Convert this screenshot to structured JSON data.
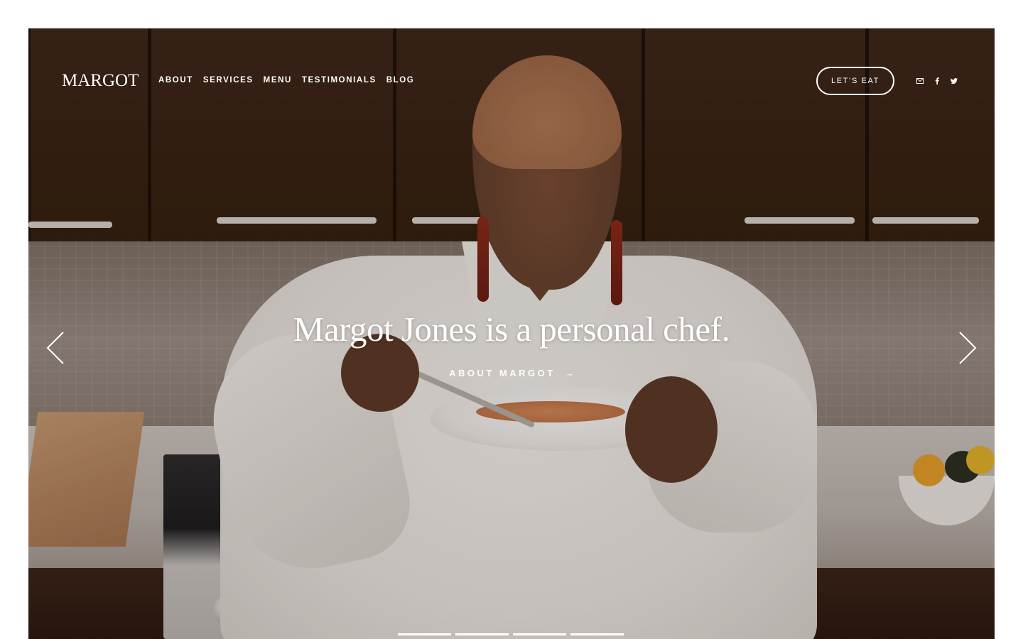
{
  "header": {
    "logo": "MARGOT",
    "nav": [
      "ABOUT",
      "SERVICES",
      "MENU",
      "TESTIMONIALS",
      "BLOG"
    ],
    "cta_label": "LET’S EAT",
    "social_icons": [
      "mail-icon",
      "facebook-icon",
      "twitter-icon"
    ]
  },
  "hero": {
    "headline": "Margot Jones is a personal chef.",
    "link_label": "ABOUT MARGOT",
    "link_arrow": "→",
    "slide_count": 4,
    "active_slide": 1
  },
  "colors": {
    "text": "#ffffff",
    "cabinet": "#3b2419",
    "coat": "#f3f0ec"
  }
}
